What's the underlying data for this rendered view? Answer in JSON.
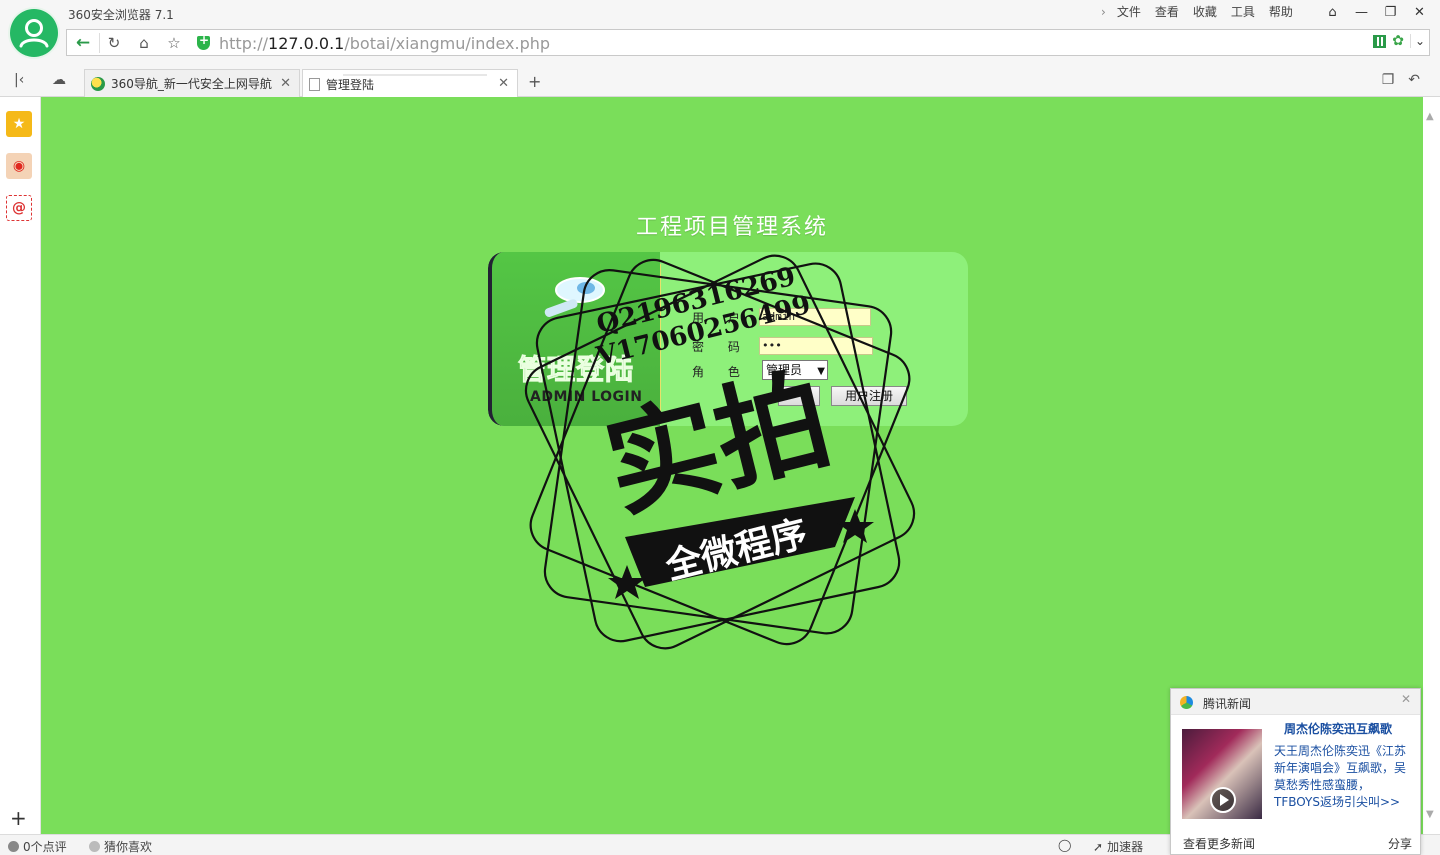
{
  "window": {
    "title": "360安全浏览器 7.1",
    "menu": [
      "文件",
      "查看",
      "收藏",
      "工具",
      "帮助"
    ],
    "controls": [
      "⌂",
      "—",
      "❐",
      "✕"
    ]
  },
  "address": {
    "url_scheme": "http://",
    "url_host": "127.0.0.1",
    "url_path": "/botai/xiangmu/index.php"
  },
  "tabs": [
    {
      "label": "360导航_新一代安全上网导航",
      "active": false
    },
    {
      "label": "管理登陆",
      "active": true
    }
  ],
  "page": {
    "system_title": "工程项目管理系统",
    "admin_cn": "管理登陆",
    "admin_en": "ADMIN LOGIN",
    "labels": {
      "user": "用 户",
      "password": "密 码",
      "role": "角 色"
    },
    "username_value": "admin",
    "password_mask": "•••",
    "role_selected": "管理员",
    "register_button": "用户注册"
  },
  "watermark": {
    "line1": "Q2196316269",
    "line2": "V17060256499",
    "big": "实拍",
    "banner": "全微程序"
  },
  "statusbar": {
    "comments": "0个点评",
    "guess": "猜你喜欢",
    "accelerator": "加速器"
  },
  "news": {
    "brand": "腾讯新闻",
    "headline": "周杰伦陈奕迅互飙歌",
    "body": "天王周杰伦陈奕迅《江苏新年演唱会》互飙歌，吴莫愁秀性感蛮腰，TFBOYS返场引尖叫>>",
    "more": "查看更多新闻",
    "share": "分享"
  }
}
